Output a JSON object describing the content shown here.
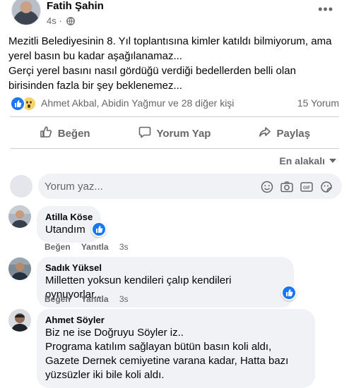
{
  "post": {
    "author": "Fatih Şahin",
    "time": "4s",
    "text_lines": [
      "Mezitli Belediyesinin 8. Yıl toplantısına kimler katıldı bilmiyorum, ama",
      "yerel basın bu kadar aşağılanamaz...",
      "Gerçi yerel basını nasıl gördüğü verdiği bedellerden belli olan",
      "birisinden fazla bir şey beklenemez..."
    ],
    "reactions_text": "Ahmet Akbal, Abidin Yağmur ve 28 diğer kişi",
    "reaction_types": [
      "like-icon",
      "wow-icon"
    ],
    "comment_count": "15 Yorum"
  },
  "actions": {
    "like": "Beğen",
    "comment": "Yorum Yap",
    "share": "Paylaş"
  },
  "sort": {
    "label": "En alakalı"
  },
  "composer": {
    "placeholder": "Yorum yaz..."
  },
  "comments": [
    {
      "name": "Atilla Köse",
      "lines": [
        "Utandım"
      ],
      "like_label": "Beğen",
      "reply_label": "Yanıtla",
      "time": "3s"
    },
    {
      "name": "Sadık Yüksel",
      "lines": [
        "Milletten yoksun kendileri çalıp kendileri oynuyorlar.."
      ],
      "like_label": "Beğen",
      "reply_label": "Yanıtla",
      "time": "3s"
    },
    {
      "name": "Ahmet Söyler",
      "lines": [
        "Biz ne ise Doğruyu Söyler iz..",
        "Programa katılım sağlayan bütün basın koli aldı,",
        "Gazete Dernek cemiyetine varana kadar, Hatta bazı",
        "yüzsüzler iki bile koli aldı."
      ]
    }
  ],
  "colors": {
    "accent": "#1877f2",
    "muted_text": "#65676b",
    "bubble_bg": "#f0f2f5"
  }
}
